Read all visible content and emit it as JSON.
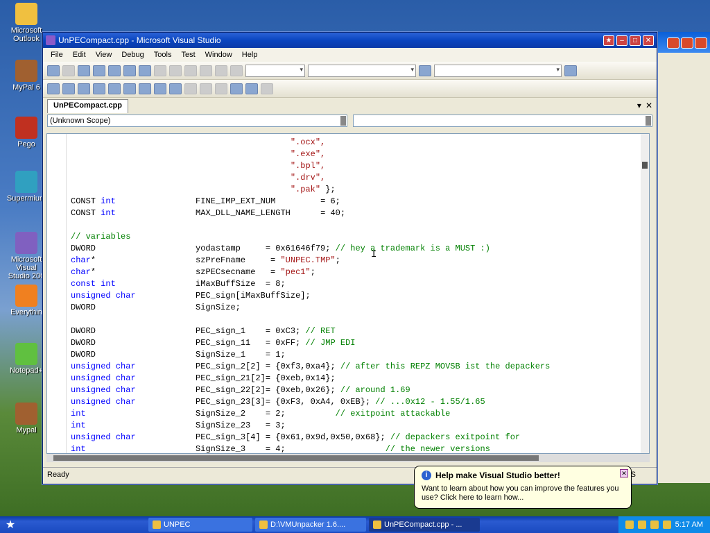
{
  "desktop_icons": [
    {
      "label": "Microsoft Outlook",
      "color": "#f0c040"
    },
    {
      "label": "MyPal 6",
      "color": "#a06030"
    },
    {
      "label": "Pego",
      "color": "#c03020"
    },
    {
      "label": "Supermium",
      "color": "#30a0c0"
    },
    {
      "label": "Microsoft Visual Studio 200",
      "color": "#8060c0"
    },
    {
      "label": "Everythin",
      "color": "#f08020"
    },
    {
      "label": "Notepad+",
      "color": "#60c040"
    },
    {
      "label": "Mypal",
      "color": "#a06030"
    }
  ],
  "window": {
    "title": "UnPECompact.cpp - Microsoft Visual Studio"
  },
  "menu": [
    "File",
    "Edit",
    "View",
    "Debug",
    "Tools",
    "Test",
    "Window",
    "Help"
  ],
  "tab": {
    "label": "UnPECompact.cpp"
  },
  "scope": {
    "left": "(Unknown Scope)",
    "right": ""
  },
  "code_lines": [
    [
      {
        "t": "                                            \".ocx\",",
        "c": "st"
      }
    ],
    [
      {
        "t": "                                            \".exe\",",
        "c": "st"
      }
    ],
    [
      {
        "t": "                                            \".bpl\",",
        "c": "st"
      }
    ],
    [
      {
        "t": "                                            \".drv\",",
        "c": "st"
      }
    ],
    [
      {
        "t": "                                            \".pak\"",
        "c": "st"
      },
      {
        "t": " };",
        "c": ""
      }
    ],
    [
      {
        "t": "CONST ",
        "c": ""
      },
      {
        "t": "int",
        "c": "kw"
      },
      {
        "t": "                FINE_IMP_EXT_NUM         = 6;",
        "c": ""
      }
    ],
    [
      {
        "t": "CONST ",
        "c": ""
      },
      {
        "t": "int",
        "c": "kw"
      },
      {
        "t": "                MAX_DLL_NAME_LENGTH      = 40;",
        "c": ""
      }
    ],
    [
      {
        "t": "",
        "c": ""
      }
    ],
    [
      {
        "t": "// variables",
        "c": "cm"
      }
    ],
    [
      {
        "t": "DWORD                    yodastamp     = 0x61646f79; ",
        "c": ""
      },
      {
        "t": "// hey a trademark is a MUST :)",
        "c": "cm"
      }
    ],
    [
      {
        "t": "char",
        "c": "kw"
      },
      {
        "t": "*                    szPreFname     = ",
        "c": ""
      },
      {
        "t": "\"UNPEC.TMP\"",
        "c": "st"
      },
      {
        "t": ";",
        "c": ""
      }
    ],
    [
      {
        "t": "char",
        "c": "kw"
      },
      {
        "t": "*                    szPECsecname   = ",
        "c": ""
      },
      {
        "t": "\"pec1\"",
        "c": "st"
      },
      {
        "t": ";",
        "c": ""
      }
    ],
    [
      {
        "t": "const int",
        "c": "kw"
      },
      {
        "t": "                iMaxBuffSize  = 8;",
        "c": ""
      }
    ],
    [
      {
        "t": "unsigned char",
        "c": "kw"
      },
      {
        "t": "            PEC_sign[iMaxBuffSize];",
        "c": ""
      }
    ],
    [
      {
        "t": "DWORD                    SignSize;",
        "c": ""
      }
    ],
    [
      {
        "t": "",
        "c": ""
      }
    ],
    [
      {
        "t": "DWORD                    PEC_sign_1    = 0xC3; ",
        "c": ""
      },
      {
        "t": "// RET",
        "c": "cm"
      }
    ],
    [
      {
        "t": "DWORD                    PEC_sign_11   = 0xFF; ",
        "c": ""
      },
      {
        "t": "// JMP EDI",
        "c": "cm"
      }
    ],
    [
      {
        "t": "DWORD                    SignSize_1    = 1;",
        "c": ""
      }
    ],
    [
      {
        "t": "unsigned char",
        "c": "kw"
      },
      {
        "t": "            PEC_sign_2[2] = {0xf3,0xa4}; ",
        "c": ""
      },
      {
        "t": "// after this REPZ MOVSB ist the depackers",
        "c": "cm"
      }
    ],
    [
      {
        "t": "unsigned char",
        "c": "kw"
      },
      {
        "t": "            PEC_sign_21[2]= {0xeb,0x14};",
        "c": ""
      }
    ],
    [
      {
        "t": "unsigned char",
        "c": "kw"
      },
      {
        "t": "            PEC_sign_22[2]= {0xeb,0x26}; ",
        "c": ""
      },
      {
        "t": "// around 1.69",
        "c": "cm"
      }
    ],
    [
      {
        "t": "unsigned char",
        "c": "kw"
      },
      {
        "t": "            PEC_sign_23[3]= {0xF3, 0xA4, 0xEB}; ",
        "c": ""
      },
      {
        "t": "// ...0x12 - 1.55/1.65",
        "c": "cm"
      }
    ],
    [
      {
        "t": "int",
        "c": "kw"
      },
      {
        "t": "                      SignSize_2    = 2;          ",
        "c": ""
      },
      {
        "t": "// exitpoint attackable",
        "c": "cm"
      }
    ],
    [
      {
        "t": "int",
        "c": "kw"
      },
      {
        "t": "                      SignSize_23   = 3;",
        "c": ""
      }
    ],
    [
      {
        "t": "unsigned char",
        "c": "kw"
      },
      {
        "t": "            PEC_sign_3[4] = {0x61,0x9d,0x50,0x68}; ",
        "c": ""
      },
      {
        "t": "// depackers exitpoint for",
        "c": "cm"
      }
    ],
    [
      {
        "t": "int",
        "c": "kw"
      },
      {
        "t": "                      SignSize_3    = 4;                    ",
        "c": ""
      },
      {
        "t": "// the newer versions",
        "c": "cm"
      }
    ]
  ],
  "status": {
    "text": "Ready",
    "right": "IS"
  },
  "balloon": {
    "title": "Help make Visual Studio better!",
    "text": "Want to learn about how you can improve the features you use? Click here to learn how..."
  },
  "taskbar": {
    "items": [
      {
        "label": "UNPEC",
        "active": false
      },
      {
        "label": "D:\\VMUnpacker 1.6....",
        "active": false
      },
      {
        "label": "UnPECompact.cpp - ...",
        "active": true
      }
    ],
    "clock": "5:17 AM"
  },
  "colors": {
    "keyword": "#0000ff",
    "comment": "#008000",
    "string": "#a31515"
  }
}
